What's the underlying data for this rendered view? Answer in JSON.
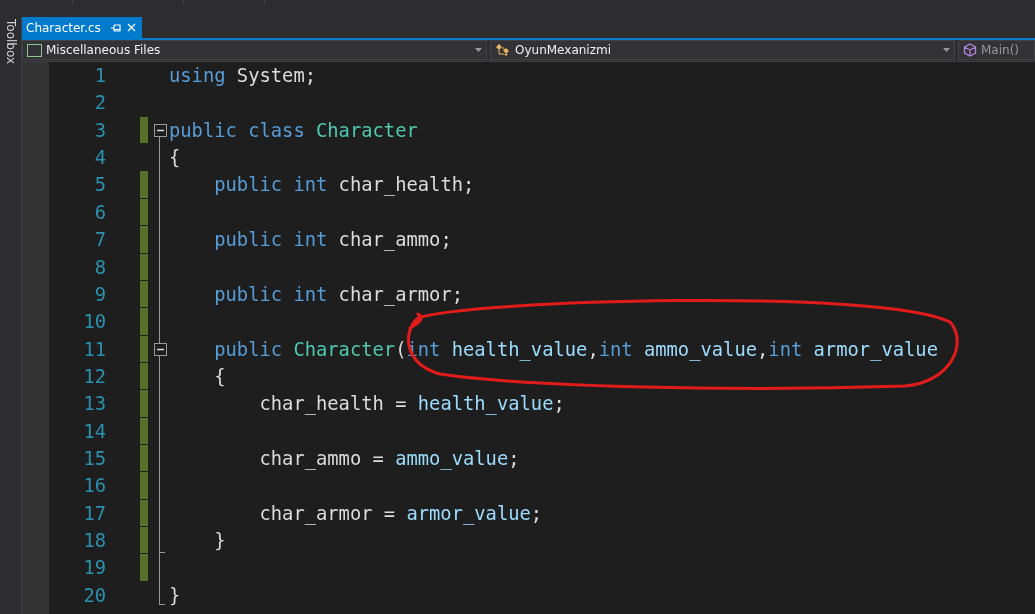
{
  "side_panel": {
    "label": "Toolbox"
  },
  "tab": {
    "label": "Character.cs",
    "selected": true
  },
  "nav_bar": [
    {
      "kind": "project",
      "label": "Miscellaneous Files"
    },
    {
      "kind": "class",
      "label": "OyunMexanizmi"
    },
    {
      "kind": "member",
      "label": "Main()"
    }
  ],
  "lines": [
    {
      "number": "1",
      "changed": false,
      "tokens": [
        {
          "kind": "keyword",
          "text": "using"
        },
        {
          "kind": "plain",
          "text": " System;"
        }
      ]
    },
    {
      "number": "2",
      "changed": false
    },
    {
      "number": "3",
      "changed": true,
      "expanded": true,
      "tokens": [
        {
          "kind": "keyword",
          "text": "public class "
        },
        {
          "kind": "type",
          "text": "Character"
        }
      ]
    },
    {
      "number": "4",
      "changed": false,
      "tokens": [
        {
          "kind": "plain",
          "text": "{"
        }
      ]
    },
    {
      "number": "5",
      "changed": true,
      "tokens": [
        {
          "kind": "keyword",
          "text": "    public int"
        },
        {
          "kind": "plain",
          "text": " char_health;"
        }
      ]
    },
    {
      "number": "6",
      "changed": true
    },
    {
      "number": "7",
      "changed": true,
      "tokens": [
        {
          "kind": "keyword",
          "text": "    public int"
        },
        {
          "kind": "plain",
          "text": " char_ammo;"
        }
      ]
    },
    {
      "number": "8",
      "changed": true
    },
    {
      "number": "9",
      "changed": true,
      "tokens": [
        {
          "kind": "keyword",
          "text": "    public int"
        },
        {
          "kind": "plain",
          "text": " char_armor;"
        }
      ]
    },
    {
      "number": "10",
      "changed": true
    },
    {
      "number": "11",
      "changed": true,
      "expanded": true,
      "tokens": [
        {
          "kind": "keyword",
          "text": "    public "
        },
        {
          "kind": "type",
          "text": "Character"
        },
        {
          "kind": "plain",
          "text": "("
        },
        {
          "kind": "keyword",
          "text": "int "
        },
        {
          "kind": "param",
          "text": "health_value"
        },
        {
          "kind": "plain",
          "text": ","
        },
        {
          "kind": "keyword",
          "text": "int "
        },
        {
          "kind": "param",
          "text": "ammo_value"
        },
        {
          "kind": "plain",
          "text": ","
        },
        {
          "kind": "keyword",
          "text": "int "
        },
        {
          "kind": "param",
          "text": "armor_value"
        }
      ]
    },
    {
      "number": "12",
      "changed": true,
      "tokens": [
        {
          "kind": "plain",
          "text": "    {"
        }
      ]
    },
    {
      "number": "13",
      "changed": true,
      "tokens": [
        {
          "kind": "plain",
          "text": "        char_health = "
        },
        {
          "kind": "param",
          "text": "health_value"
        },
        {
          "kind": "plain",
          "text": ";"
        }
      ]
    },
    {
      "number": "14",
      "changed": true
    },
    {
      "number": "15",
      "changed": true,
      "tokens": [
        {
          "kind": "plain",
          "text": "        char_ammo = "
        },
        {
          "kind": "param",
          "text": "ammo_value"
        },
        {
          "kind": "plain",
          "text": ";"
        }
      ]
    },
    {
      "number": "16",
      "changed": true
    },
    {
      "number": "17",
      "changed": true,
      "tokens": [
        {
          "kind": "plain",
          "text": "        char_armor = "
        },
        {
          "kind": "param",
          "text": "armor_value"
        },
        {
          "kind": "plain",
          "text": ";"
        }
      ]
    },
    {
      "number": "18",
      "changed": true,
      "block_end": true,
      "tokens": [
        {
          "kind": "plain",
          "text": "    }"
        }
      ]
    },
    {
      "number": "19",
      "changed": true
    },
    {
      "number": "20",
      "changed": false,
      "block_end": true,
      "tokens": [
        {
          "kind": "plain",
          "text": "}"
        }
      ]
    }
  ]
}
